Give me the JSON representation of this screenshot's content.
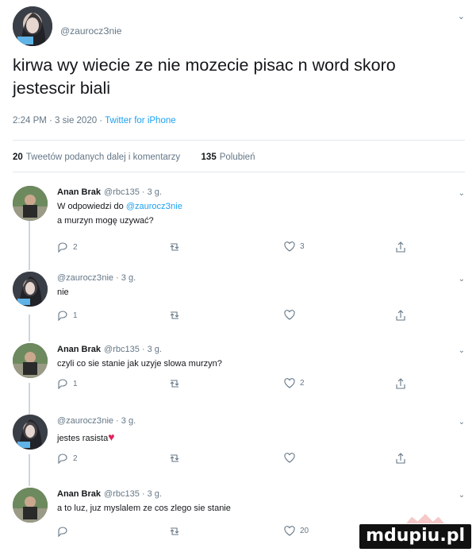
{
  "main_tweet": {
    "handle": "@zauroczЗnie",
    "text_line1": "kirwa wy wiecie ze nie mozecie pisac n word skoro",
    "text_line2": "jestescir biali",
    "timestamp": "2:24 PM · 3 sie 2020 ·",
    "source": "Twitter for iPhone",
    "retweet_count": "20",
    "retweet_label": "Tweetów podanych dalej i komentarzy",
    "like_count": "135",
    "like_label": "Polubień"
  },
  "replies": [
    {
      "name": "Anan Brak",
      "handle_time": "@rbc135 · 3 g.",
      "reply_to_prefix": "W odpowiedzi do",
      "reply_to": "@zauroczЗnie",
      "text": "a murzyn mogę uzywać?",
      "reply_count": "2",
      "like_count": "3"
    },
    {
      "handle_time": "@zauroczЗnie · 3 g.",
      "text": "nie",
      "reply_count": "1",
      "like_count": ""
    },
    {
      "name": "Anan Brak",
      "handle_time": "@rbc135 · 3 g.",
      "text": "czyli co sie stanie jak uzyje slowa murzyn?",
      "reply_count": "1",
      "like_count": "2"
    },
    {
      "handle_time": "@zauroczЗnie · 3 g.",
      "text": "jestes rasista",
      "reply_count": "2",
      "like_count": ""
    },
    {
      "name": "Anan Brak",
      "handle_time": "@rbc135 · 3 g.",
      "text": "a to luz, juz myslalem ze cos zlego sie stanie",
      "reply_count": "",
      "like_count": "20"
    }
  ],
  "watermark": "mdupiu.pl",
  "colors": {
    "link": "#1da1f2",
    "muted": "#657786",
    "divider": "#e1e8ed",
    "heart": "#e0245e"
  },
  "icons": [
    "chevron-down-icon",
    "reply-icon",
    "retweet-icon",
    "like-icon",
    "share-icon"
  ]
}
